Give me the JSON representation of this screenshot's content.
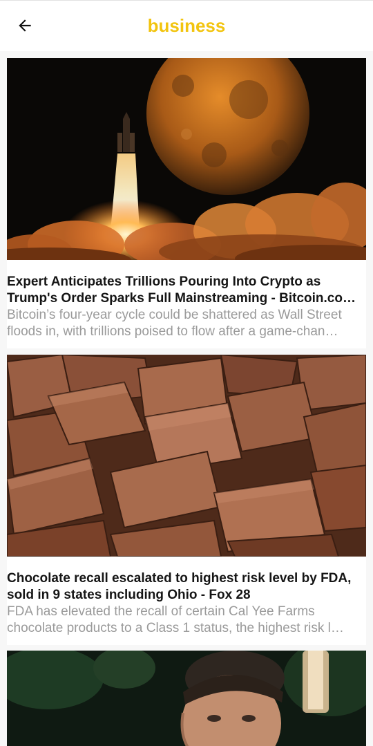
{
  "header": {
    "title": "business",
    "back_icon": "arrow-left-icon",
    "title_color": "#f2c40f"
  },
  "articles": [
    {
      "image": "rocket-launch-moon-image",
      "headline_line1": "Expert Anticipates Trillions Pouring Into Crypto as",
      "headline_line2": "Trump's Order Sparks Full Mainstreaming - Bitcoin.com…",
      "desc_line1": "Bitcoin’s four-year cycle could be shattered as Wall Street",
      "desc_line2": "floods in, with trillions poised to flow after a game-chan…"
    },
    {
      "image": "chocolate-blocks-image",
      "headline_line1": "Chocolate recall escalated to highest risk level by FDA,",
      "headline_line2": "sold in 9 states including Ohio - Fox 28",
      "desc_line1": "FDA has elevated the recall of certain Cal Yee Farms",
      "desc_line2": "chocolate products to a Class 1 status, the highest risk l…"
    },
    {
      "image": "man-portrait-image"
    }
  ]
}
